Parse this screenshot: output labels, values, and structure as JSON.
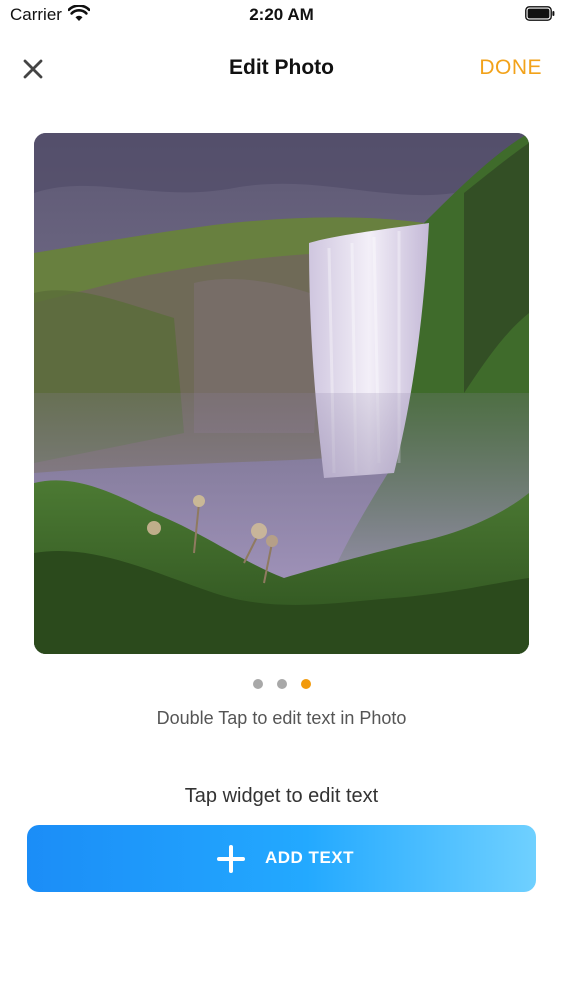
{
  "status_bar": {
    "carrier": "Carrier",
    "time": "2:20 AM"
  },
  "nav": {
    "title": "Edit Photo",
    "done_label": "DONE"
  },
  "photo": {
    "description_icon": "waterfall-photo"
  },
  "pager": {
    "count": 3,
    "active_index": 2
  },
  "hints": {
    "photo_hint": "Double Tap to edit text in Photo",
    "widget_hint": "Tap widget to edit text"
  },
  "add_button": {
    "label": "ADD TEXT",
    "icon": "plus-icon"
  },
  "colors": {
    "accent": "#f2a21a",
    "button_gradient_start": "#1b8df7",
    "button_gradient_end": "#6fd0ff",
    "dot_inactive": "#a8a8a8",
    "dot_active": "#f29a0c"
  }
}
